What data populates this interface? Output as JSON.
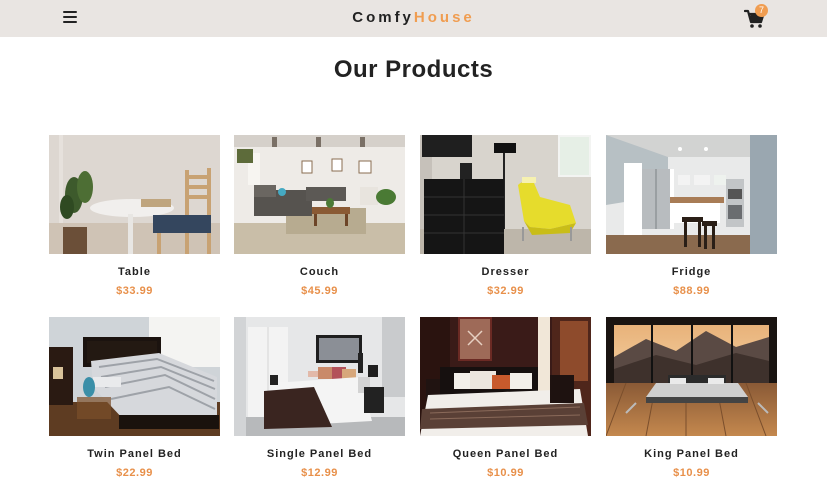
{
  "navbar": {
    "logo_part1": "Comfy",
    "logo_part2": "House",
    "cart_count": "7",
    "menu_icon": "hamburger-icon",
    "cart_icon": "shopping-cart-icon",
    "accent_color": "#f09d51",
    "background_color": "#e9e5e2"
  },
  "main": {
    "title": "Our Products",
    "products": [
      {
        "name": "Table",
        "price": "$33.99"
      },
      {
        "name": "Couch",
        "price": "$45.99"
      },
      {
        "name": "Dresser",
        "price": "$32.99"
      },
      {
        "name": "Fridge",
        "price": "$88.99"
      },
      {
        "name": "Twin Panel Bed",
        "price": "$22.99"
      },
      {
        "name": "Single Panel Bed",
        "price": "$12.99"
      },
      {
        "name": "Queen Panel Bed",
        "price": "$10.99"
      },
      {
        "name": "King Panel Bed",
        "price": "$10.99"
      }
    ]
  }
}
